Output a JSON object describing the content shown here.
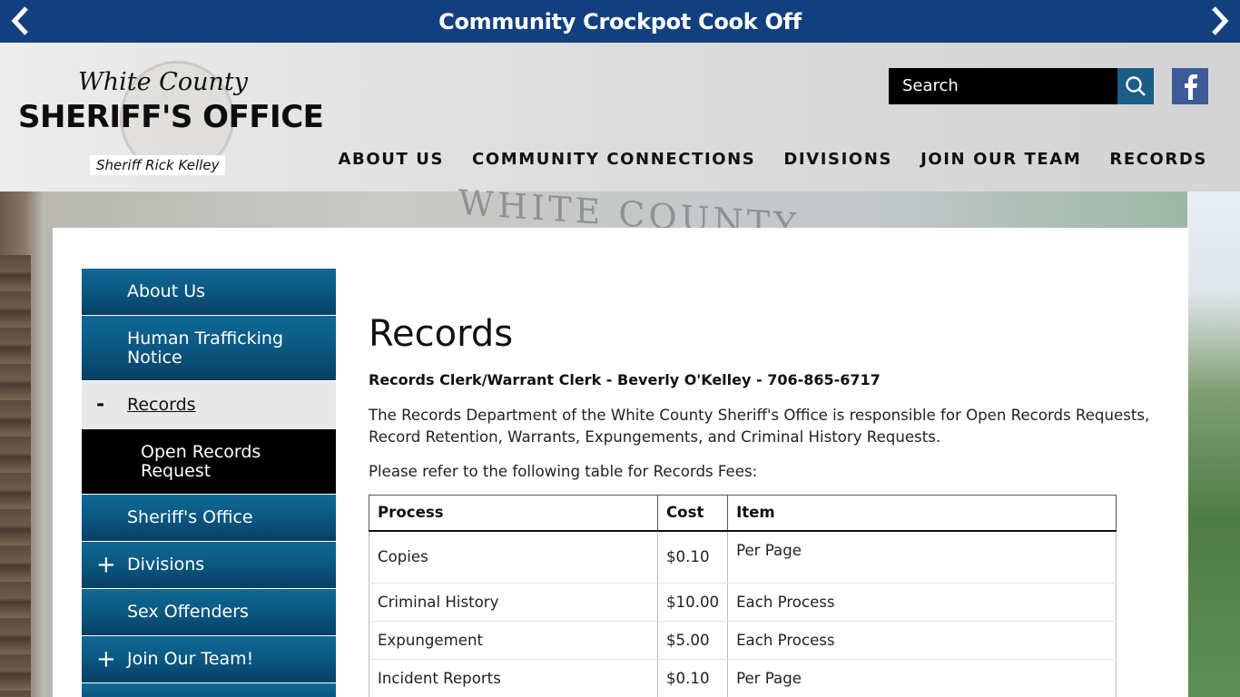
{
  "banner": {
    "title": "Community Crockpot Cook Off",
    "prev_icon": "chevron-left-icon",
    "next_icon": "chevron-right-icon"
  },
  "logo": {
    "line1": "White County",
    "line2": "SHERIFF'S OFFICE",
    "line3": "Sheriff Rick Kelley"
  },
  "search": {
    "placeholder": "Search",
    "icon": "search-icon"
  },
  "social": {
    "facebook_icon": "facebook-icon",
    "facebook_color": "#3d5b99"
  },
  "nav": {
    "items": [
      {
        "label": "ABOUT US"
      },
      {
        "label": "COMMUNITY CONNECTIONS"
      },
      {
        "label": "DIVISIONS"
      },
      {
        "label": "JOIN OUR TEAM"
      },
      {
        "label": "RECORDS"
      }
    ]
  },
  "hero": {
    "building_text": "WHITE COUNTY"
  },
  "sidebar": {
    "items": [
      {
        "label": "About Us",
        "mark": ""
      },
      {
        "label": "Human Trafficking Notice",
        "mark": ""
      },
      {
        "label": "Records",
        "mark": "-"
      },
      {
        "label": "Open Records Request",
        "mark": ""
      },
      {
        "label": "Sheriff's Office",
        "mark": ""
      },
      {
        "label": "Divisions",
        "mark": "+"
      },
      {
        "label": "Sex Offenders",
        "mark": ""
      },
      {
        "label": "Join Our Team!",
        "mark": "+"
      }
    ]
  },
  "main": {
    "title": "Records",
    "clerk": "Records Clerk/Warrant Clerk - Beverly O'Kelley - 706-865-6717",
    "description": "The Records Department of the White County Sheriff's Office is responsible for Open Records Requests, Record Retention, Warrants, Expungements, and Criminal History Requests.",
    "table_intro": "Please refer to the following table for Records Fees:"
  },
  "fees_table": {
    "headers": [
      "Process",
      "Cost",
      "Item"
    ],
    "rows": [
      [
        "Copies",
        "$0.10",
        "Per Page"
      ],
      [
        "Criminal History",
        "$10.00",
        "Each Process"
      ],
      [
        "Expungement",
        "$5.00",
        "Each Process"
      ],
      [
        "Incident Reports",
        "$0.10",
        "Per Page"
      ]
    ]
  },
  "colors": {
    "banner": "#123f7e",
    "sidebar_blue": "#0a5782",
    "search_button": "#1a5d86"
  }
}
